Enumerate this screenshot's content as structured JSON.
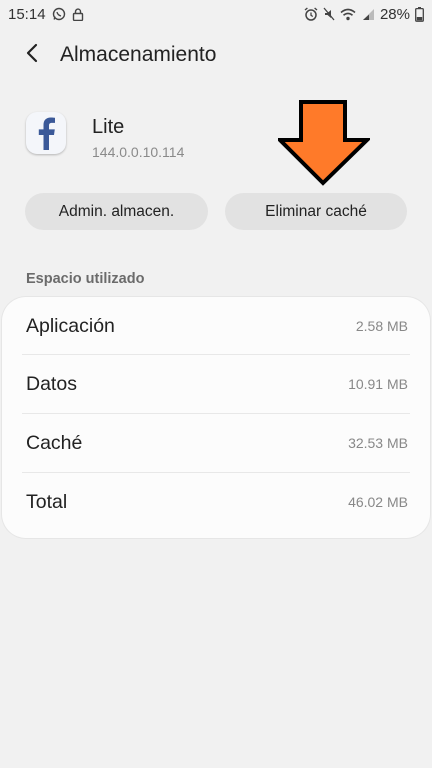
{
  "status_bar": {
    "time": "15:14",
    "battery": "28%"
  },
  "header": {
    "title": "Almacenamiento"
  },
  "app": {
    "name": "Lite",
    "version": "144.0.0.10.114",
    "icon": "facebook-f-icon"
  },
  "buttons": {
    "manage_label": "Admin. almacen.",
    "clear_cache_label": "Eliminar caché"
  },
  "section": {
    "label": "Espacio utilizado"
  },
  "storage_rows": [
    {
      "label": "Aplicación",
      "value": "2.58 MB"
    },
    {
      "label": "Datos",
      "value": "10.91 MB"
    },
    {
      "label": "Caché",
      "value": "32.53 MB"
    },
    {
      "label": "Total",
      "value": "46.02 MB"
    }
  ],
  "colors": {
    "arrow": "#ff7a29",
    "facebook_blue": "#3b5998"
  }
}
